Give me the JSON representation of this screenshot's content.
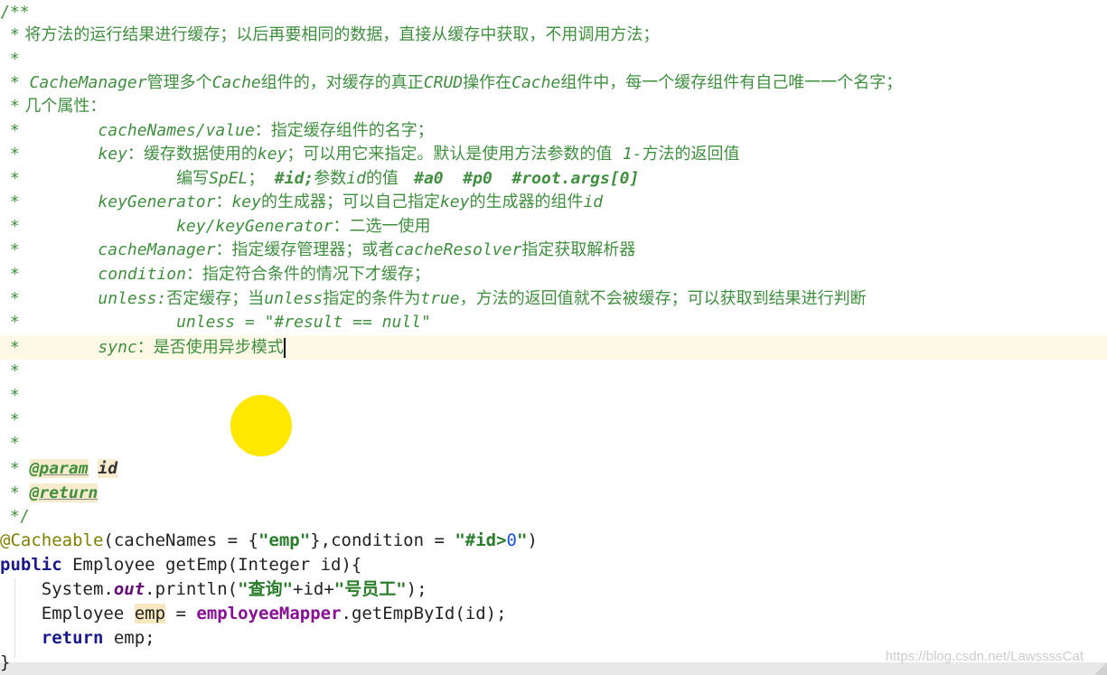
{
  "comment": {
    "open": "/**",
    "close": " */",
    "star": " *",
    "line1": " 将方法的运行结果进行缓存；以后再要相同的数据，直接从缓存中获取，不用调用方法；",
    "line3_a": "CacheManager",
    "line3_b": "管理多个",
    "line3_c": "Cache",
    "line3_d": "组件的，对缓存的真正",
    "line3_e": "CRUD",
    "line3_f": "操作在",
    "line3_g": "Cache",
    "line3_h": "组件中，每一个缓存组件有自己唯一一个名字；",
    "line4": " 几个属性：",
    "attrs": {
      "cacheNames_key": "cacheNames/value",
      "cacheNames_desc": "：指定缓存组件的名字；",
      "key_key": "key",
      "key_desc_a": "：缓存数据使用的",
      "key_desc_b": "key",
      "key_desc_c": "；可以用它来指定。默认是使用方法参数的值  ",
      "key_desc_d": "1-",
      "key_desc_e": "方法的返回值",
      "spel_a": "编写",
      "spel_b": "SpEL",
      "spel_c": "；  ",
      "spel_d": "#id;",
      "spel_e": "参数",
      "spel_f": "id",
      "spel_g": "的值   ",
      "spel_h": "#a0  #p0  #root.args[0]",
      "kg_key": "keyGenerator",
      "kg_desc_a": "：",
      "kg_desc_b": "key",
      "kg_desc_c": "的生成器；可以自己指定",
      "kg_desc_d": "key",
      "kg_desc_e": "的生成器的组件",
      "kg_desc_f": "id",
      "kk_key": "key/keyGenerator",
      "kk_desc": "：二选一使用",
      "cm_key": "cacheManager",
      "cm_desc_a": "：指定缓存管理器；或者",
      "cm_desc_b": "cacheResolver",
      "cm_desc_c": "指定获取解析器",
      "cond_key": "condition",
      "cond_desc": "：指定符合条件的情况下才缓存；",
      "unless_key": "unless:",
      "unless_desc_a": "否定缓存；当",
      "unless_desc_b": "unless",
      "unless_desc_c": "指定的条件为",
      "unless_desc_d": "true",
      "unless_desc_e": "，方法的返回值就不会被缓存；可以获取到结果进行判断",
      "unless_example": "unless = \"#result == null\"",
      "sync_key": "sync",
      "sync_desc": "：是否使用异步模式"
    },
    "param_tag": "@param",
    "param_name": "id",
    "return_tag": "@return"
  },
  "code": {
    "annotation": "@Cacheable",
    "anno_args_a": "(cacheNames = {",
    "anno_args_str1": "\"emp\"",
    "anno_args_b": "},condition = ",
    "anno_args_str2a": "\"#id>",
    "anno_args_num": "0",
    "anno_args_str2b": "\"",
    "anno_args_c": ")",
    "kw_public": "public",
    "sig": " Employee getEmp(Integer id){",
    "l3_a": "    System.",
    "l3_out": "out",
    "l3_b": ".println(",
    "l3_str1": "\"查询\"",
    "l3_c": "+id+",
    "l3_str2": "\"号员工\"",
    "l3_d": ");",
    "l4_a": "    Employee ",
    "l4_var": "emp",
    "l4_b": " = ",
    "l4_field": "employeeMapper",
    "l4_c": ".getEmpById(id);",
    "l5_indent": "    ",
    "kw_return": "return",
    "l5_b": " emp;",
    "close": "}"
  },
  "watermark": "https://blog.csdn.net/LawssssCat"
}
